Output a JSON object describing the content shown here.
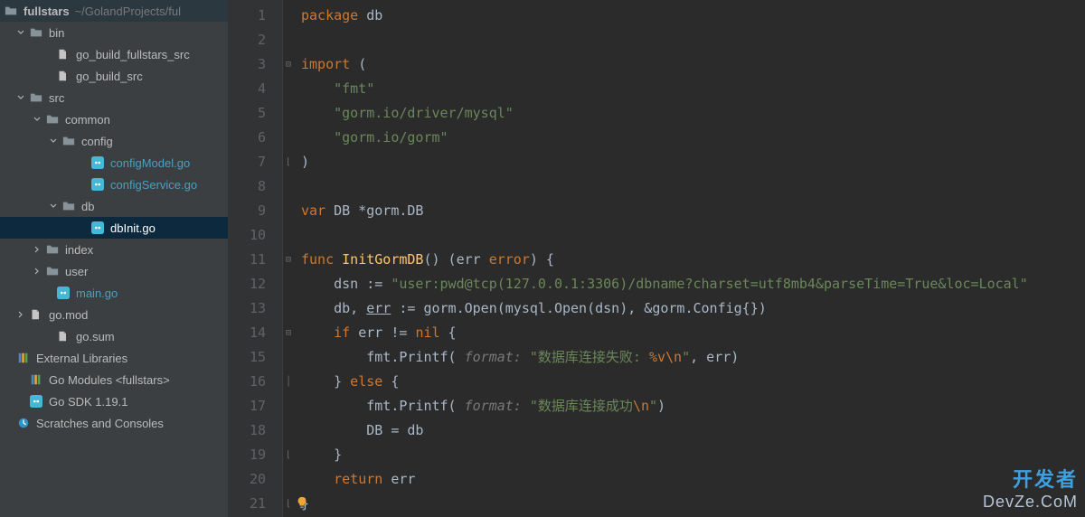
{
  "sidebar": {
    "root": {
      "name": "fullstars",
      "path": "~/GolandProjects/ful"
    },
    "items": [
      {
        "indent": 18,
        "chev": "down",
        "icon": "folder",
        "label": "bin",
        "go": false
      },
      {
        "indent": 48,
        "chev": "",
        "icon": "file",
        "label": "go_build_fullstars_src",
        "go": false
      },
      {
        "indent": 48,
        "chev": "",
        "icon": "file",
        "label": "go_build_src",
        "go": false
      },
      {
        "indent": 18,
        "chev": "down",
        "icon": "folder",
        "label": "src",
        "go": false
      },
      {
        "indent": 36,
        "chev": "down",
        "icon": "folder",
        "label": "common",
        "go": false
      },
      {
        "indent": 54,
        "chev": "down",
        "icon": "folder",
        "label": "config",
        "go": false
      },
      {
        "indent": 86,
        "chev": "",
        "icon": "go",
        "label": "configModel.go",
        "go": true
      },
      {
        "indent": 86,
        "chev": "",
        "icon": "go",
        "label": "configService.go",
        "go": true
      },
      {
        "indent": 54,
        "chev": "down",
        "icon": "folder",
        "label": "db",
        "go": false
      },
      {
        "indent": 86,
        "chev": "",
        "icon": "go",
        "label": "dbInit.go",
        "go": true,
        "sel": true
      },
      {
        "indent": 36,
        "chev": "right",
        "icon": "folder",
        "label": "index",
        "go": false
      },
      {
        "indent": 36,
        "chev": "right",
        "icon": "folder",
        "label": "user",
        "go": false
      },
      {
        "indent": 48,
        "chev": "",
        "icon": "go",
        "label": "main.go",
        "go": true
      },
      {
        "indent": 18,
        "chev": "right",
        "icon": "file",
        "label": "go.mod",
        "go": false,
        "edit": true
      },
      {
        "indent": 48,
        "chev": "",
        "icon": "file",
        "label": "go.sum",
        "go": false
      },
      {
        "indent": 4,
        "chev": "",
        "icon": "lib",
        "label": "External Libraries",
        "go": false
      },
      {
        "indent": 18,
        "chev": "",
        "icon": "lib",
        "label": "Go Modules <fullstars>",
        "go": false
      },
      {
        "indent": 18,
        "chev": "",
        "icon": "go",
        "label": "Go SDK 1.19.1",
        "go": false
      },
      {
        "indent": 4,
        "chev": "",
        "icon": "scratch",
        "label": "Scratches and Consoles",
        "go": false
      }
    ]
  },
  "editor": {
    "line_numbers": [
      "1",
      "2",
      "3",
      "4",
      "5",
      "6",
      "7",
      "8",
      "9",
      "10",
      "11",
      "12",
      "13",
      "14",
      "15",
      "16",
      "17",
      "18",
      "19",
      "20",
      "21"
    ],
    "fold_marks": {
      "3": "open",
      "7": "close",
      "11": "open",
      "14": "open",
      "16": "mid",
      "19": "close",
      "21": "close"
    },
    "bulb_line": 21,
    "code": {
      "l1": {
        "kw": "package",
        "ident": " db"
      },
      "l3": {
        "kw": "import",
        "paren": " ("
      },
      "l4": {
        "str": "\"fmt\""
      },
      "l5": {
        "str": "\"gorm.io/driver/mysql\""
      },
      "l6": {
        "str": "\"gorm.io/gorm\""
      },
      "l7": {
        "paren": ")"
      },
      "l9": {
        "kw": "var",
        "rest": " DB *gorm.DB"
      },
      "l11": {
        "kw": "func",
        "fn": " InitGormDB",
        "sig1": "() (err ",
        "sig_kw": "error",
        "sig2": ") {"
      },
      "l12": {
        "ident": "dsn ",
        "op": ":=",
        "str": " \"user:pwd@tcp(127.0.0.1:3306)/dbname?charset=utf8mb4&parseTime=True&loc=Local\""
      },
      "l13": {
        "pre": "db, ",
        "err": "err",
        "op": " := ",
        "call": "gorm.Open(mysql.Open(dsn), &gorm.Config{})"
      },
      "l14": {
        "kw": "if",
        "cond": " err != ",
        "nil": "nil",
        "brace": " {"
      },
      "l15": {
        "call": "fmt.Printf(",
        "hint": " format: ",
        "str1": "\"数据库连接失败: ",
        "esc": "%v\\n",
        "str2": "\"",
        "args": ", err)"
      },
      "l16": {
        "close": "}",
        "kw": " else",
        "brace": " {"
      },
      "l17": {
        "call": "fmt.Printf(",
        "hint": " format: ",
        "str1": "\"数据库连接成功",
        "esc": "\\n",
        "str2": "\"",
        "args": ")"
      },
      "l18": {
        "stmt": "DB = db"
      },
      "l19": {
        "close": "}"
      },
      "l20": {
        "kw": "return",
        "rest": " err"
      },
      "l21": {
        "close": "}"
      }
    }
  },
  "watermark": {
    "line1": "开发者",
    "line2": "DevZe.CoM"
  }
}
